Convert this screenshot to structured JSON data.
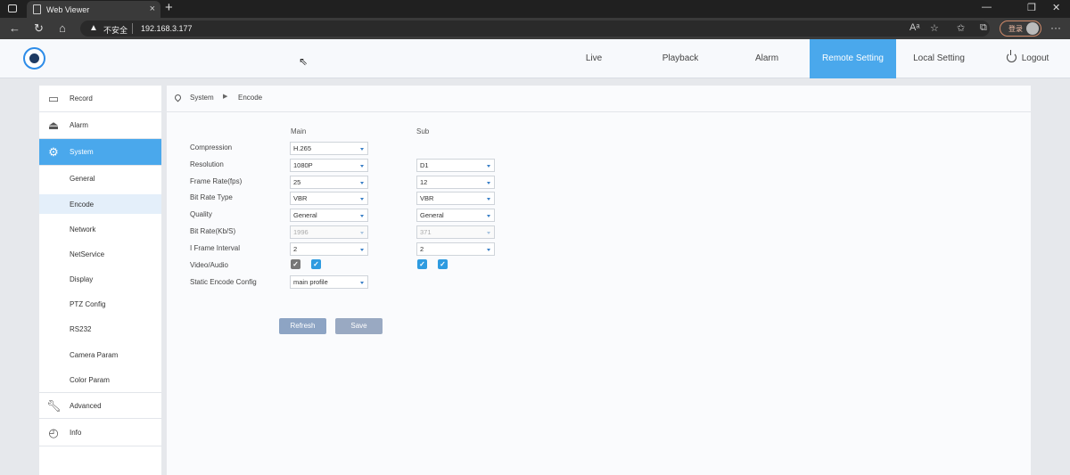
{
  "browser": {
    "tab_title": "Web Viewer",
    "security_label": "不安全",
    "url": "192.168.3.177",
    "login_label": "登录"
  },
  "topnav": {
    "items": [
      "Live",
      "Playback",
      "Alarm",
      "Remote Setting",
      "Local Setting"
    ],
    "logout_label": "Logout",
    "active": "Remote Setting"
  },
  "sidebar": {
    "main_items": [
      {
        "label": "Record",
        "icon": "camera-icon"
      },
      {
        "label": "Alarm",
        "icon": "alarm-siren-icon"
      },
      {
        "label": "System",
        "icon": "gear-icon"
      },
      {
        "label": "Advanced",
        "icon": "wrench-icon"
      },
      {
        "label": "Info",
        "icon": "chart-icon"
      }
    ],
    "sub_items": [
      "General",
      "Encode",
      "Network",
      "NetService",
      "Display",
      "PTZ Config",
      "RS232",
      "Camera Param",
      "Color Param"
    ],
    "active_main": "System",
    "active_sub": "Encode"
  },
  "breadcrumb": {
    "section": "System",
    "page": "Encode"
  },
  "form": {
    "columns": {
      "main": "Main",
      "sub": "Sub"
    },
    "labels": {
      "compression": "Compression",
      "resolution": "Resolution",
      "frame_rate": "Frame Rate(fps)",
      "bit_rate_type": "Bit Rate Type",
      "quality": "Quality",
      "bit_rate": "Bit Rate(Kb/S)",
      "i_frame_interval": "I Frame Interval",
      "video_audio": "Video/Audio",
      "static_encode_config": "Static Encode Config"
    },
    "main": {
      "compression": "H.265",
      "resolution": "1080P",
      "frame_rate": "25",
      "bit_rate_type": "VBR",
      "quality": "General",
      "bit_rate": "1996",
      "i_frame_interval": "2",
      "video_checked": true,
      "audio_checked": true,
      "static_encode_config": "main profile"
    },
    "sub": {
      "resolution": "D1",
      "frame_rate": "12",
      "bit_rate_type": "VBR",
      "quality": "General",
      "bit_rate": "371",
      "i_frame_interval": "2",
      "video_checked": true,
      "audio_checked": true
    },
    "buttons": {
      "refresh": "Refresh",
      "save": "Save"
    }
  },
  "colors": {
    "accent": "#4aa8ec",
    "checkbox": "#2e9be0",
    "button": "#8da4c4"
  }
}
